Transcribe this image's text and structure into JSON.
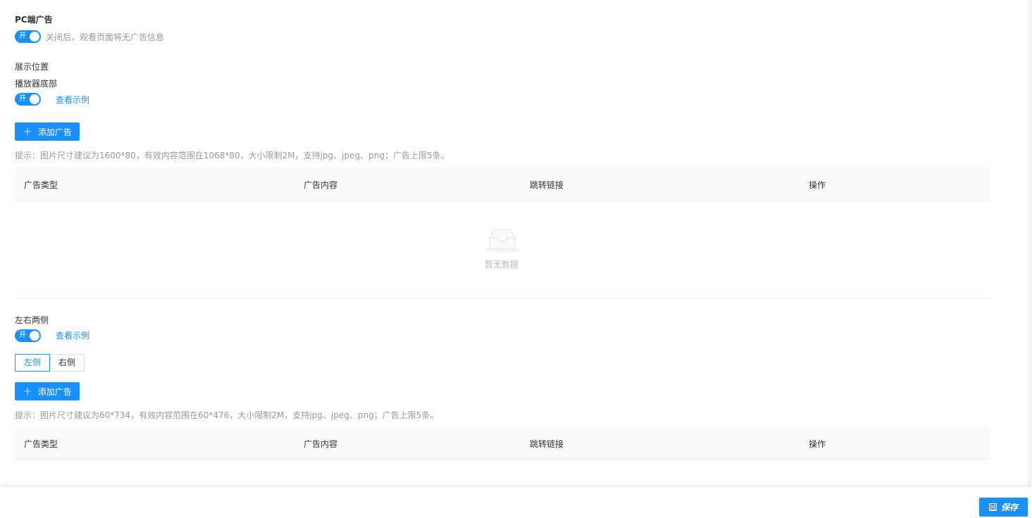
{
  "pc_ad": {
    "title": "PC端广告",
    "toggle_text": "开",
    "toggle_hint": "关闭后，观看页面将无广告信息"
  },
  "display_position": {
    "title": "展示位置"
  },
  "player_bottom": {
    "label": "播放器底部",
    "toggle_text": "开",
    "example_link": "查看示例",
    "add_button": "添加广告",
    "hint": "提示：图片尺寸建议为1600*80，有效内容范围在1068*80，大小限制2M，支持jpg、jpeg、png；广告上限5条。",
    "table": {
      "columns": [
        "广告类型",
        "广告内容",
        "跳转链接",
        "操作"
      ],
      "rows": [],
      "empty_text": "暂无数据"
    }
  },
  "side_ads": {
    "label": "左右两侧",
    "toggle_text": "开",
    "example_link": "查看示例",
    "tabs": [
      "左侧",
      "右侧"
    ],
    "active_tab": "左侧",
    "add_button": "添加广告",
    "hint": "提示：图片尺寸建议为60*734，有效内容范围在60*476，大小限制2M，支持jpg、jpeg、png；广告上限5条。",
    "table": {
      "columns": [
        "广告类型",
        "广告内容",
        "跳转链接",
        "操作"
      ],
      "rows": []
    }
  },
  "footer": {
    "save_label": "保存",
    "save_icon": "save-icon"
  },
  "colors": {
    "accent": "#1890ff",
    "hint_text": "#999999",
    "table_header_bg": "#fafafa"
  }
}
